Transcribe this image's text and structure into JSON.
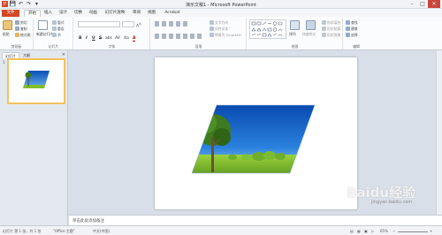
{
  "window": {
    "title": "演示文稿1 - Microsoft PowerPoint",
    "minimize": "–",
    "maximize": "□",
    "close": "✕"
  },
  "qat": {
    "save": "💾",
    "undo": "↶",
    "redo": "↷",
    "customize": "▾"
  },
  "tabs": [
    {
      "label": "文件"
    },
    {
      "label": "开始"
    },
    {
      "label": "插入"
    },
    {
      "label": "设计"
    },
    {
      "label": "切换"
    },
    {
      "label": "动画"
    },
    {
      "label": "幻灯片放映"
    },
    {
      "label": "审阅"
    },
    {
      "label": "视图"
    },
    {
      "label": "Acrobat"
    }
  ],
  "ribbon": {
    "clipboard": {
      "label": "剪贴板",
      "paste": "粘贴",
      "cut": "剪切",
      "copy": "复制",
      "format": "格式刷"
    },
    "slides": {
      "label": "幻灯片",
      "new_slide": "新建幻灯片",
      "layout": "版式",
      "reset": "重设",
      "section": "节"
    },
    "font": {
      "label": "字体",
      "bold": "B",
      "italic": "I",
      "underline": "U",
      "strike": "S",
      "shadow": "abc",
      "spacing": "AV",
      "case": "Aa",
      "color": "A"
    },
    "paragraph": {
      "label": "段落",
      "text_direction": "文字方向",
      "align_text": "对齐文本",
      "smartart": "转换为 SmartArt"
    },
    "drawing": {
      "label": "绘图",
      "arrange": "排列",
      "quick_styles": "快速样式",
      "fill": "形状填充",
      "outline": "形状轮廓",
      "effects": "形状效果"
    },
    "editing": {
      "label": "编辑",
      "find": "查找",
      "replace": "替换",
      "select": "选择"
    }
  },
  "left_pane": {
    "tabs": [
      {
        "label": "幻灯片"
      },
      {
        "label": "大纲"
      }
    ],
    "close": "×",
    "slide_number": "1"
  },
  "notes": {
    "placeholder": "单击此处添加备注"
  },
  "status": {
    "slide": "幻灯片 第 1 张，共 1 张",
    "theme": "\"Office 主题\"",
    "language": "中文(中国)",
    "zoom": "65%"
  },
  "watermark": {
    "text": "Baidu经验",
    "sub": "jingyan.baidu.com"
  },
  "colors": {
    "file_tab": "#d24726",
    "thumb_border": "#f1c15b",
    "sky": "#1c6fd1",
    "grass": "#7fbf2a"
  }
}
